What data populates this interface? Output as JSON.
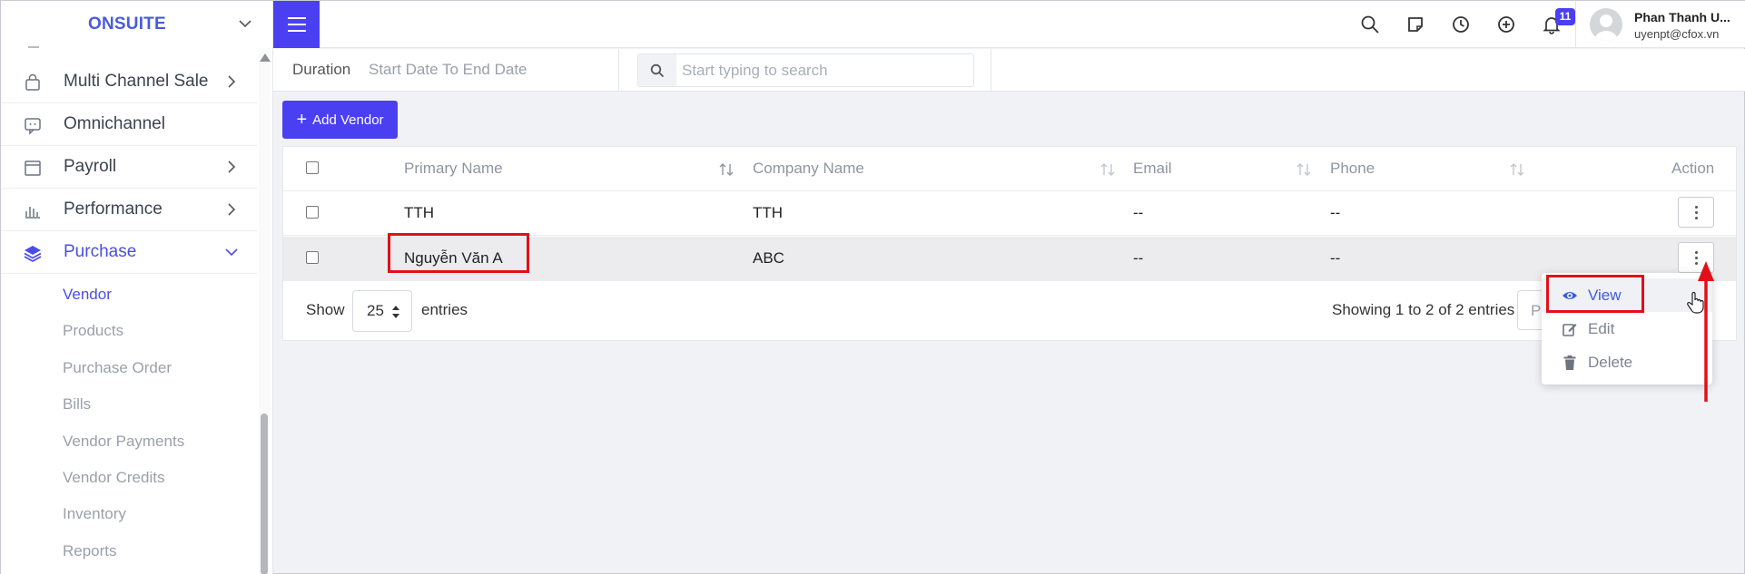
{
  "sidebar": {
    "brand": "ONSUITE",
    "items": [
      {
        "label": "Multi Channel Sale",
        "icon": "shopping-bag-icon",
        "chevron": true
      },
      {
        "label": "Omnichannel",
        "icon": "chat-icon",
        "chevron": false
      },
      {
        "label": "Payroll",
        "icon": "calendar-icon",
        "chevron": true
      },
      {
        "label": "Performance",
        "icon": "bar-chart-icon",
        "chevron": true
      },
      {
        "label": "Purchase",
        "icon": "layers-icon",
        "chevron": true
      }
    ],
    "subitems": [
      "Vendor",
      "Products",
      "Purchase Order",
      "Bills",
      "Vendor Payments",
      "Vendor Credits",
      "Inventory",
      "Reports"
    ]
  },
  "header": {
    "notification_count": "11",
    "user_name": "Phan Thanh U...",
    "user_email": "uyenpt@cfox.vn"
  },
  "filter": {
    "duration_label": "Duration",
    "date_range": "Start Date To End Date",
    "search_placeholder": "Start typing to search"
  },
  "toolbar": {
    "add_label": "Add Vendor"
  },
  "table": {
    "columns": [
      "Primary Name",
      "Company Name",
      "Email",
      "Phone",
      "Action"
    ],
    "rows": [
      {
        "primary": "TTH",
        "company": "TTH",
        "email": "--",
        "phone": "--"
      },
      {
        "primary": "Nguyễn Văn A",
        "company": "ABC",
        "email": "--",
        "phone": "--"
      }
    ]
  },
  "footer": {
    "show": "Show",
    "page_size": "25",
    "entries": "entries",
    "info": "Showing 1 to 2 of 2 entries",
    "prev": "Pr"
  },
  "menu": {
    "items": [
      "View",
      "Edit",
      "Delete"
    ]
  },
  "colors": {
    "accent": "#4b3ff2",
    "active_link": "#4b4ee6",
    "annotation": "#e20f1a"
  }
}
